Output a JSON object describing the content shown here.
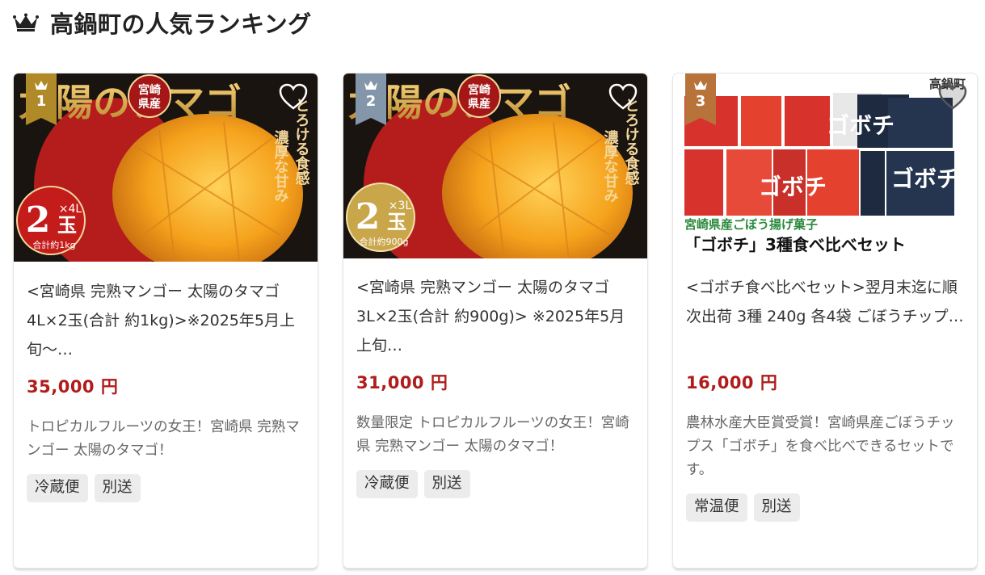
{
  "section_title": "高鍋町の人気ランキング",
  "items": [
    {
      "rank": "1",
      "image_text": {
        "headline": "太陽のタマゴ",
        "badge_top": "宮崎",
        "badge_bottom": "県産",
        "side": "とろける食感",
        "side2": "濃厚な甘み",
        "count": "2",
        "unit": "×4L",
        "size": "玉",
        "weight": "合計約1kg"
      },
      "title": "<宮崎県 完熟マンゴー 太陽のタマゴ 4L×2玉(合計 約1kg)>※2025年5月上旬～…",
      "price": "35,000 円",
      "description": "トロピカルフルーツの女王！宮崎県 完熟マンゴー 太陽のタマゴ！",
      "tags": [
        "冷蔵便",
        "別送"
      ]
    },
    {
      "rank": "2",
      "image_text": {
        "headline": "太陽のタマゴ",
        "badge_top": "宮崎",
        "badge_bottom": "県産",
        "side": "とろける食感",
        "side2": "濃厚な甘み",
        "count": "2",
        "unit": "×3L",
        "size": "玉",
        "weight": "合計約900g"
      },
      "title": "<宮崎県 完熟マンゴー 太陽のタマゴ 3L×2玉(合計 約900g)> ※2025年5月上旬…",
      "price": "31,000 円",
      "description": "数量限定 トロピカルフルーツの女王！宮崎県 完熟マンゴー 太陽のタマゴ！",
      "tags": [
        "冷蔵便",
        "別送"
      ]
    },
    {
      "rank": "3",
      "image_text": {
        "brand": "高鍋町",
        "banner1": "宮崎県産ごぼう揚げ菓子",
        "banner2": "「ゴボチ」3種食べ比べセット",
        "pack": "ゴボチ"
      },
      "title": "<ゴボチ食べ比べセット>翌月末迄に順次出荷 3種 240g 各4袋 ごぼうチップ…",
      "price": "16,000 円",
      "description": "農林水産大臣賞受賞！宮崎県産ごぼうチップス「ゴボチ」を食べ比べできるセットです。",
      "tags": [
        "常温便",
        "別送"
      ]
    }
  ],
  "colors": {
    "price": "#b01c1c",
    "rank1": "#b08a28",
    "rank2": "#8496a9",
    "rank3": "#b8733b"
  }
}
